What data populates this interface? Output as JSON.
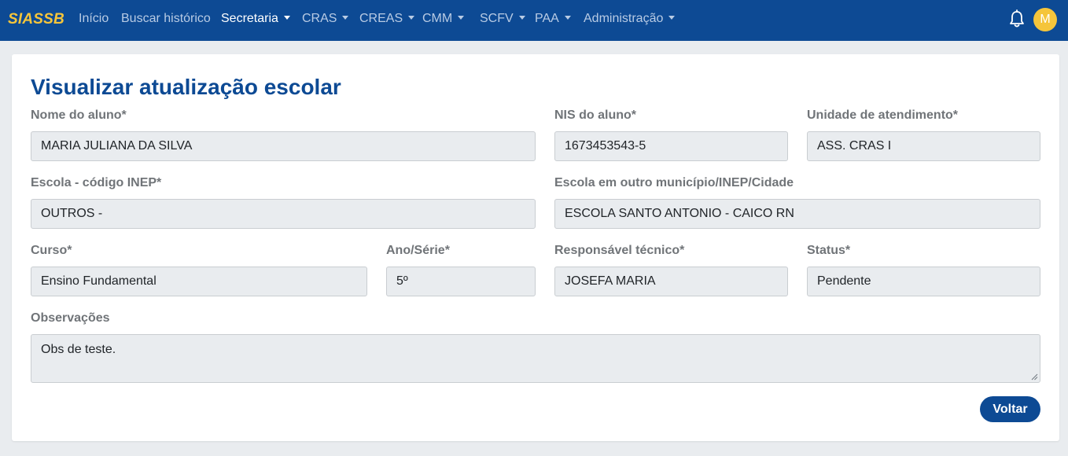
{
  "app": {
    "brand": "SIASSB",
    "avatar_initial": "M"
  },
  "nav": {
    "items": [
      {
        "label": "Início",
        "dropdown": false,
        "active": false
      },
      {
        "label": "Buscar histórico",
        "dropdown": false,
        "active": false
      },
      {
        "label": "Secretaria",
        "dropdown": true,
        "active": true
      },
      {
        "label": "CRAS",
        "dropdown": true,
        "active": false
      },
      {
        "label": "CREAS",
        "dropdown": true,
        "active": false
      },
      {
        "label": "CMM",
        "dropdown": true,
        "active": false
      },
      {
        "label": "SCFV",
        "dropdown": true,
        "active": false
      },
      {
        "label": "PAA",
        "dropdown": true,
        "active": false
      },
      {
        "label": "Administração",
        "dropdown": true,
        "active": false
      }
    ],
    "icons": {
      "notifications": "bell-icon"
    }
  },
  "page": {
    "title": "Visualizar atualização escolar"
  },
  "form": {
    "nome_aluno": {
      "label": "Nome do aluno*",
      "value": "MARIA JULIANA DA SILVA"
    },
    "nis_aluno": {
      "label": "NIS do aluno*",
      "value": "1673453543-5"
    },
    "unidade": {
      "label": "Unidade de atendimento*",
      "value": "ASS. CRAS I"
    },
    "escola_inep": {
      "label": "Escola - código INEP*",
      "value": "OUTROS -"
    },
    "escola_outro": {
      "label": "Escola em outro município/INEP/Cidade",
      "value": "ESCOLA SANTO ANTONIO - CAICO RN"
    },
    "curso": {
      "label": "Curso*",
      "value": "Ensino Fundamental"
    },
    "ano_serie": {
      "label": "Ano/Série*",
      "value": "5º"
    },
    "responsavel": {
      "label": "Responsável técnico*",
      "value": "JOSEFA MARIA"
    },
    "status": {
      "label": "Status*",
      "value": "Pendente"
    },
    "observacoes": {
      "label": "Observações",
      "value": "Obs de teste."
    }
  },
  "actions": {
    "back_label": "Voltar"
  },
  "colors": {
    "primary": "#0d4a94",
    "accent": "#f5c53b",
    "field_bg": "#e9ecef",
    "label": "#707478"
  }
}
